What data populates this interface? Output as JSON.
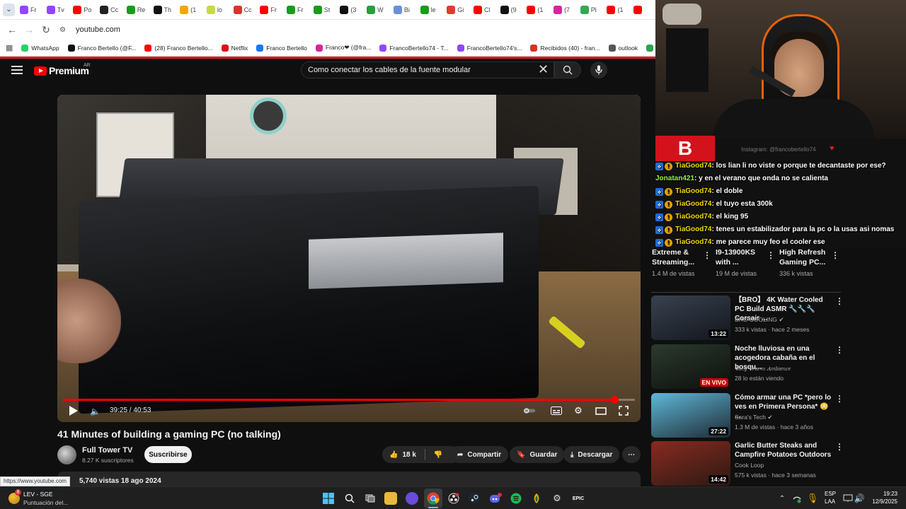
{
  "browser": {
    "tabs": [
      {
        "label": "Fr",
        "icon": "twitch-icon",
        "color": "#9146ff"
      },
      {
        "label": "Tv",
        "icon": "twitch-icon",
        "color": "#9146ff"
      },
      {
        "label": "Po",
        "icon": "youtube-icon",
        "color": "#ff0000"
      },
      {
        "label": "Cc",
        "icon": "github-icon",
        "color": "#222222"
      },
      {
        "label": "Re",
        "icon": "kick-icon",
        "color": "#1a9b1a"
      },
      {
        "label": "Th",
        "icon": "threads-icon",
        "color": "#111111"
      },
      {
        "label": "(1",
        "icon": "emoji-icon",
        "color": "#f0a800"
      },
      {
        "label": "lo",
        "icon": "bookmark-icon",
        "color": "#c8d84a"
      },
      {
        "label": "Cc",
        "icon": "link-icon",
        "color": "#d9342b"
      },
      {
        "label": "Fr",
        "icon": "youtube-icon",
        "color": "#ff0000"
      },
      {
        "label": "Fr",
        "icon": "kick-icon",
        "color": "#1a9b1a"
      },
      {
        "label": "St",
        "icon": "kick-icon",
        "color": "#1a9b1a"
      },
      {
        "label": "(3",
        "icon": "x-icon",
        "color": "#111111"
      },
      {
        "label": "W",
        "icon": "w-icon",
        "color": "#2a9d3a"
      },
      {
        "label": "Bi",
        "icon": "translate-icon",
        "color": "#6a8fd8"
      },
      {
        "label": "le",
        "icon": "kick-icon",
        "color": "#1a9b1a"
      },
      {
        "label": "Gi",
        "icon": "maps-icon",
        "color": "#e03b2e"
      },
      {
        "label": "Cl",
        "icon": "youtube-icon",
        "color": "#ff0000"
      },
      {
        "label": "(9",
        "icon": "tiktok-icon",
        "color": "#111111"
      },
      {
        "label": "(1",
        "icon": "youtube-icon",
        "color": "#ff0000"
      },
      {
        "label": "(7",
        "icon": "instagram-icon",
        "color": "#d6249f"
      },
      {
        "label": "Pl",
        "icon": "globe-icon",
        "color": "#35a853"
      },
      {
        "label": "(1",
        "icon": "youtube-icon",
        "color": "#ff0000"
      },
      {
        "label": "",
        "icon": "youtube-icon",
        "color": "#ff0000"
      }
    ],
    "url": "youtube.com",
    "bookmarks": [
      {
        "label": "WhatsApp",
        "icon": "whatsapp-icon",
        "color": "#25d366"
      },
      {
        "label": "Franco Bertello (@F...",
        "icon": "x-icon",
        "color": "#111111"
      },
      {
        "label": "(28) Franco Bertello...",
        "icon": "youtube-icon",
        "color": "#ff0000"
      },
      {
        "label": "Netflix",
        "icon": "netflix-icon",
        "color": "#e50914"
      },
      {
        "label": "Franco Bertello",
        "icon": "facebook-icon",
        "color": "#1877f2"
      },
      {
        "label": "Franco❤ (@fra...",
        "icon": "instagram-icon",
        "color": "#d6249f"
      },
      {
        "label": "FrancoBertello74 - T...",
        "icon": "twitch-icon",
        "color": "#9146ff"
      },
      {
        "label": "FrancoBertello74's...",
        "icon": "twitch-icon",
        "color": "#9146ff"
      },
      {
        "label": "Recibidos (40) - fran...",
        "icon": "gmail-icon",
        "color": "#d93025"
      },
      {
        "label": "outlook",
        "icon": "globe-icon",
        "color": "#555555"
      },
      {
        "label": "Aler",
        "icon": "alert-icon",
        "color": "#2aa54a"
      }
    ]
  },
  "youtube": {
    "logo_text": "Premium",
    "country": "AR",
    "search_query": "Como conectar los cables de la fuente modular",
    "player": {
      "time": "39:25 / 40:53",
      "progress": 0.964
    },
    "video_title": "41 Minutes of building a gaming PC (no talking)",
    "channel": {
      "name": "Full Tower TV",
      "subs": "8.27 K suscriptores",
      "subscribe": "Suscribirse"
    },
    "actions": {
      "likes": "18 k",
      "share": "Compartir",
      "save": "Guardar",
      "download": "Descargar"
    },
    "description_meta": "5,740 vistas  18 ago 2024",
    "status_url": "https://www.youtube.com"
  },
  "stream_overlay": {
    "instagram": "Instagram: @francobertello74",
    "logo_letter": "B",
    "chat": [
      {
        "user": "TiaGood74",
        "msg": ": los lian li no viste o porque te decantaste por ese?",
        "badges": [
          "prime",
          "sub"
        ],
        "green": false
      },
      {
        "user": "Jonatan421",
        "msg": ": y en el verano que onda no se calienta",
        "badges": [],
        "green": true
      },
      {
        "user": "TiaGood74",
        "msg": ": el doble",
        "badges": [
          "prime",
          "sub"
        ],
        "green": false
      },
      {
        "user": "TiaGood74",
        "msg": ": el tuyo esta 300k",
        "badges": [
          "prime",
          "sub"
        ],
        "green": false
      },
      {
        "user": "TiaGood74",
        "msg": ": el king 95",
        "badges": [
          "prime",
          "sub"
        ],
        "green": false
      },
      {
        "user": "TiaGood74",
        "msg": ": tenes un estabilizador para la pc o la usas asi nomas",
        "badges": [
          "prime",
          "sub"
        ],
        "green": false
      },
      {
        "user": "TiaGood74",
        "msg": ": me parece muy feo el cooler ese",
        "badges": [
          "prime",
          "sub"
        ],
        "green": false
      }
    ]
  },
  "recommendations_top": [
    {
      "title": "Extreme & Streaming...",
      "views": "1.4 M de vistas"
    },
    {
      "title": "I9-13900KS with ...",
      "views": "19 M de vistas"
    },
    {
      "title": "High Refresh Gaming PC...",
      "views": "336 k vistas"
    }
  ],
  "recommendations": [
    {
      "title": "【BRO】 4K Water Cooled PC Build ASMR 🔧🔧🔧 Corsair ...",
      "channel": "BRO COOLING ✔",
      "meta": "333 k vistas · hace 2 meses",
      "duration": "13:22",
      "live": false,
      "colors": [
        "#3a4250",
        "#12161c"
      ]
    },
    {
      "title": "Noche lluviosa en una acogedora cabaña en el bosqu...",
      "channel": "𝓒𝑜𝑧𝑦 𝒲𝑎𝑟𝑚 𝐴𝑚𝑏𝑖𝑒𝑛𝑐𝑒",
      "meta": "28 lo están viendo",
      "duration": "EN VIVO",
      "live": true,
      "colors": [
        "#2c3a2e",
        "#0c0f0c"
      ]
    },
    {
      "title": "Cómo armar una PC *pero lo ves en Primera Persona* 😳 ...",
      "channel": "Sara's Tech ✔",
      "meta": "1.3 M de vistas · hace 3 años",
      "duration": "27:22",
      "live": false,
      "colors": [
        "#5fb8d8",
        "#1e2a33"
      ]
    },
    {
      "title": "Garlic Butter Steaks and Campfire Potatoes Outdoors",
      "channel": "Cook Loop",
      "meta": "575 k vistas · hace 3 semanas",
      "duration": "14:42",
      "live": false,
      "colors": [
        "#8a2a20",
        "#2a1a12"
      ]
    }
  ],
  "taskbar": {
    "weather_title": "LEV - SGE",
    "weather_sub": "Puntuación del...",
    "weather_badge": "8",
    "lang1": "ESP",
    "lang2": "LAA",
    "time": "19:23",
    "date": "12/9/2025"
  }
}
